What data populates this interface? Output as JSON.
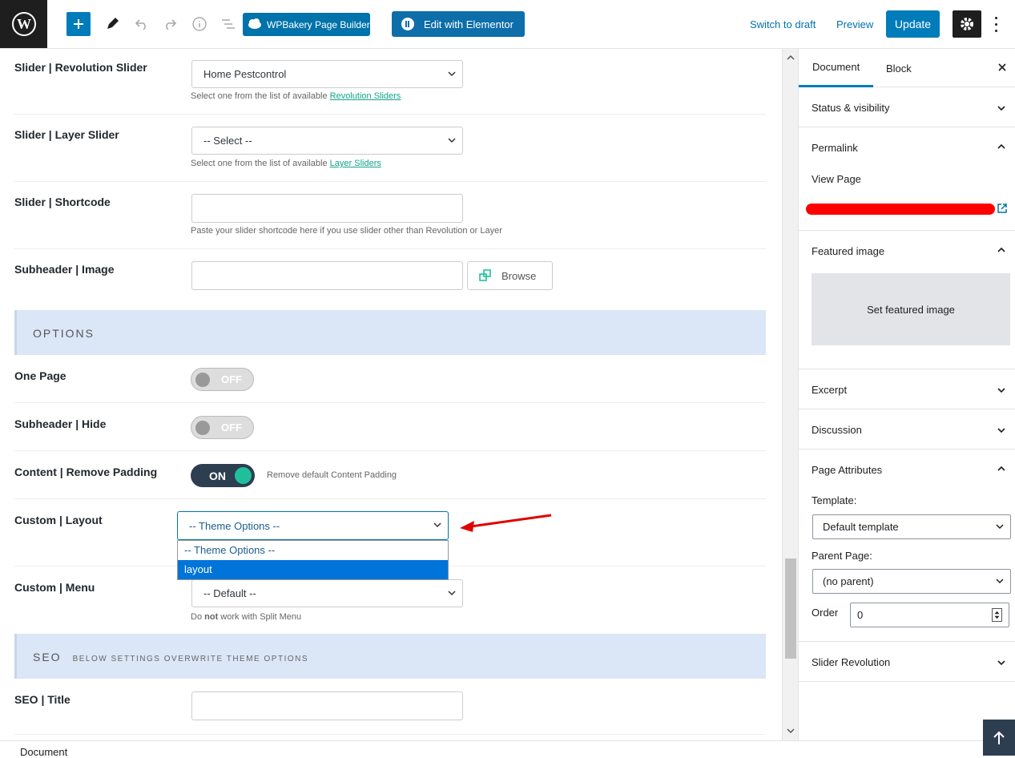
{
  "toolbar": {
    "wpbakery_label": "WPBakery Page Builder",
    "elementor_label": "Edit with Elementor",
    "switch_draft": "Switch to draft",
    "preview": "Preview",
    "update": "Update"
  },
  "main": {
    "rev_slider": {
      "label": "Slider | Revolution Slider",
      "value": "Home Pestcontrol",
      "desc_prefix": "Select one from the list of available",
      "desc_link": "Revolution Sliders"
    },
    "layer_slider": {
      "label": "Slider | Layer Slider",
      "value": "-- Select --",
      "desc_prefix": "Select one from the list of available",
      "desc_link": "Layer Sliders"
    },
    "shortcode": {
      "label": "Slider | Shortcode",
      "desc": "Paste your slider shortcode here if you use slider other than Revolution or Layer"
    },
    "subheader_image": {
      "label": "Subheader | Image",
      "browse": "Browse"
    },
    "options_title": "OPTIONS",
    "one_page": {
      "label": "One Page",
      "state": "OFF"
    },
    "subheader_hide": {
      "label": "Subheader | Hide",
      "state": "OFF"
    },
    "content_padding": {
      "label": "Content | Remove Padding",
      "state": "ON",
      "desc": "Remove default Content Padding"
    },
    "custom_layout": {
      "label": "Custom | Layout",
      "value": "-- Theme Options --",
      "options": [
        "-- Theme Options --",
        "layout"
      ],
      "selected_index": 1
    },
    "custom_menu": {
      "label": "Custom | Menu",
      "value": "-- Default --",
      "desc_pre": "Do ",
      "desc_bold": "not",
      "desc_post": " work with Split Menu"
    },
    "seo_title": "SEO",
    "seo_sub": "BELOW SETTINGS OVERWRITE THEME OPTIONS",
    "seo_field": {
      "label": "SEO | Title"
    }
  },
  "sidebar": {
    "tabs": [
      "Document",
      "Block"
    ],
    "status": "Status & visibility",
    "permalink": "Permalink",
    "view_page": "View Page",
    "featured": "Featured image",
    "set_featured": "Set featured image",
    "excerpt": "Excerpt",
    "discussion": "Discussion",
    "page_attributes": "Page Attributes",
    "template_label": "Template:",
    "template_value": "Default template",
    "parent_label": "Parent Page:",
    "parent_value": "(no parent)",
    "order_label": "Order",
    "order_value": "0",
    "slider_rev": "Slider Revolution"
  },
  "footer": {
    "breadcrumb": "Document"
  },
  "colors": {
    "accent": "#007cba",
    "toggle_on": "#2d3e50",
    "knob_on": "#1fbf9b",
    "band": "#dbe6f6",
    "annotation": "#e00000"
  }
}
